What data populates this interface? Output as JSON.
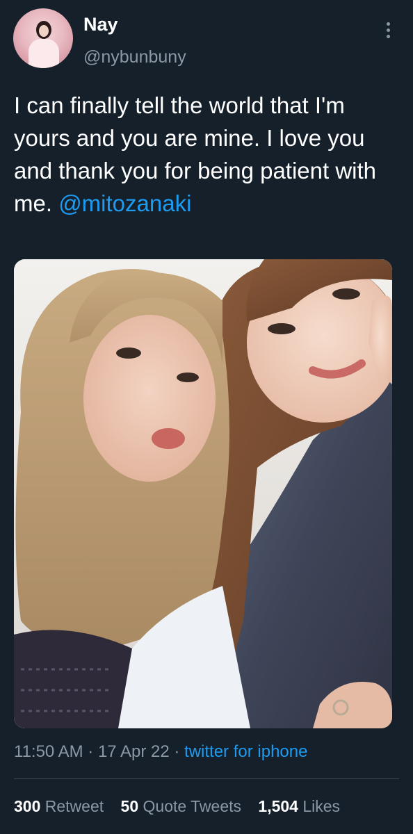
{
  "user": {
    "display_name": "Nay",
    "handle": "@nybunbuny"
  },
  "tweet": {
    "text": "I can finally tell the world that I'm yours and you are mine. I love you and thank you for being patient with me.",
    "mention": "@mitozanaki"
  },
  "meta": {
    "time": "11:50 AM",
    "sep1": " · ",
    "date": "17 Apr 22",
    "sep2": " · ",
    "source": "twitter for iphone"
  },
  "stats": {
    "retweets_count": "300",
    "retweets_label": "Retweet",
    "quotes_count": "50",
    "quotes_label": "Quote Tweets",
    "likes_count": "1,504",
    "likes_label": "Likes"
  },
  "icons": {
    "more": "more-vertical-icon"
  },
  "colors": {
    "background": "#15202b",
    "text": "#ffffff",
    "secondary": "#8b98a5",
    "link": "#1d9bf0",
    "divider": "#38444d"
  }
}
